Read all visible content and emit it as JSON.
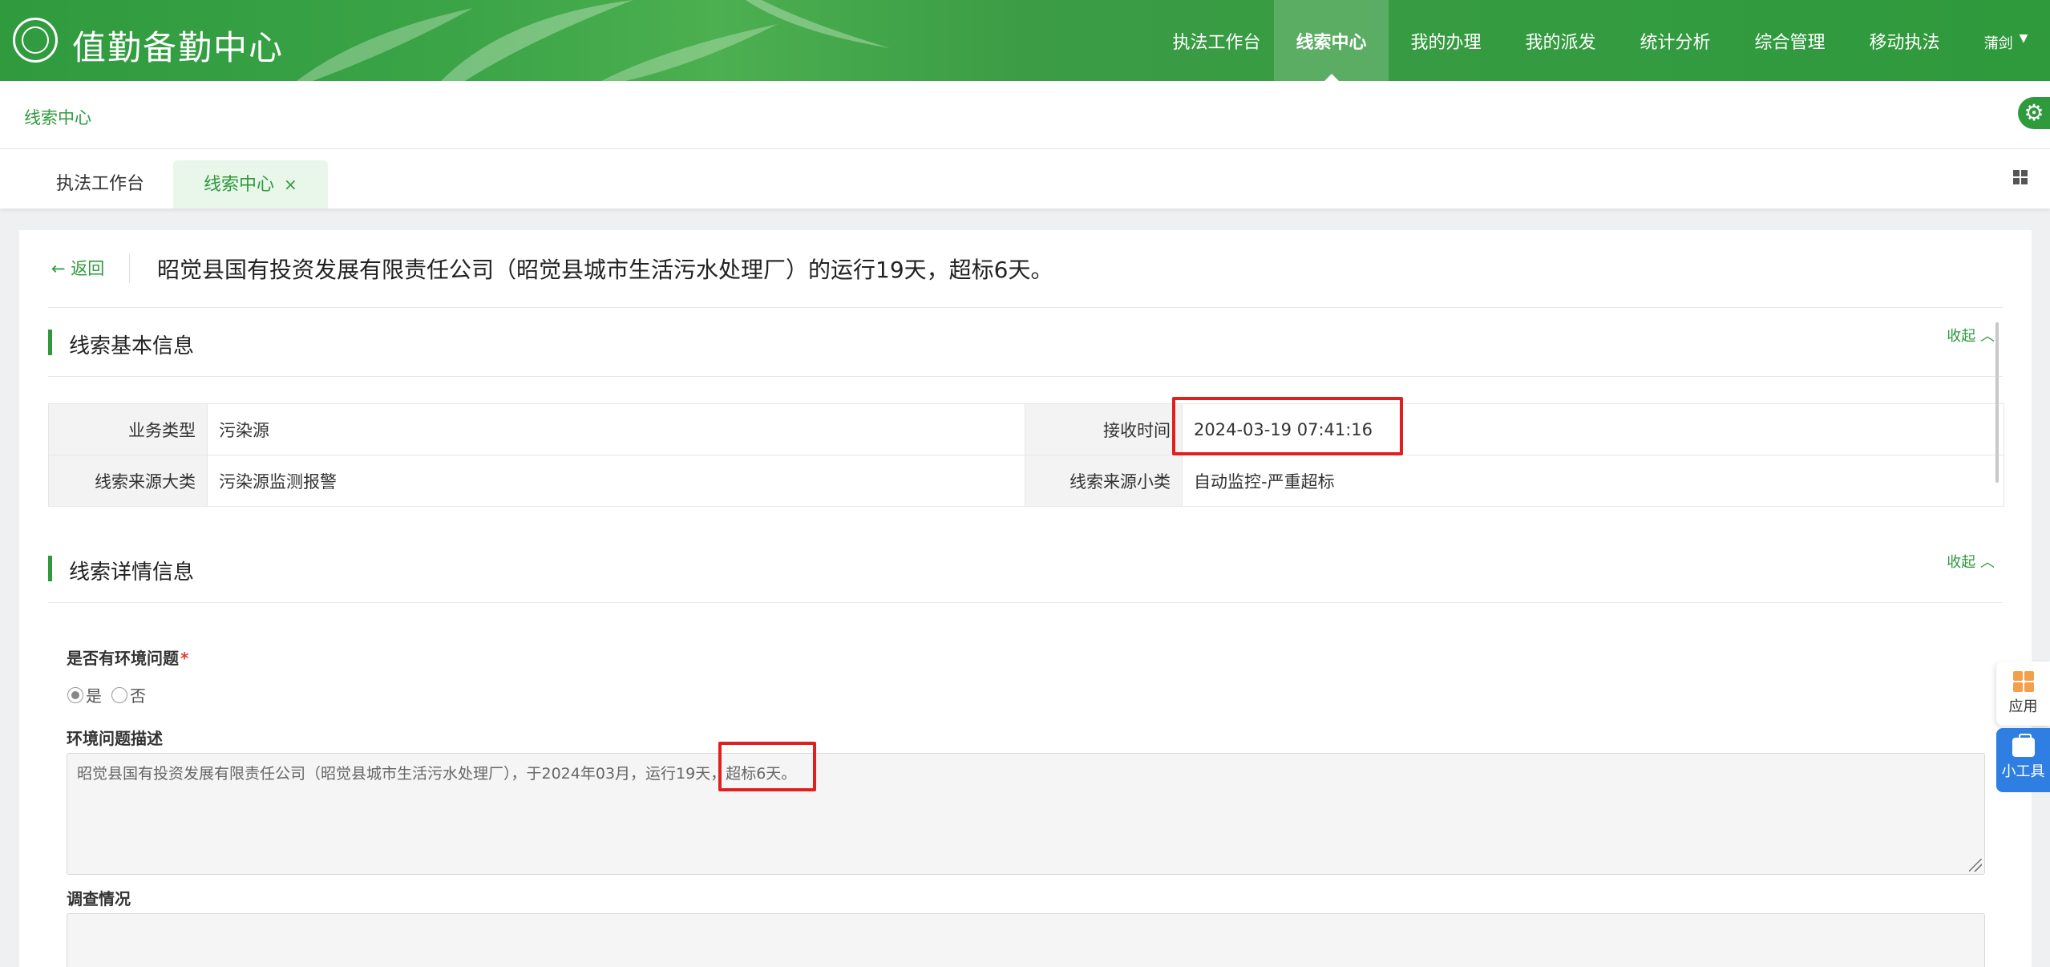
{
  "app": {
    "title": "值勤备勤中心"
  },
  "nav": {
    "items": [
      {
        "label": "执法工作台",
        "active": false
      },
      {
        "label": "线索中心",
        "active": true
      },
      {
        "label": "我的办理",
        "active": false
      },
      {
        "label": "我的派发",
        "active": false
      },
      {
        "label": "统计分析",
        "active": false
      },
      {
        "label": "综合管理",
        "active": false
      },
      {
        "label": "移动执法",
        "active": false
      }
    ],
    "user": "蒲剑"
  },
  "breadcrumb": "线索中心",
  "tabs": [
    {
      "label": "执法工作台",
      "active": false
    },
    {
      "label": "线索中心",
      "active": true,
      "close": "×"
    }
  ],
  "page": {
    "back": "返回",
    "title": "昭觉县国有投资发展有限责任公司（昭觉县城市生活污水处理厂）的运行19天，超标6天。"
  },
  "basic_info": {
    "title": "线索基本信息",
    "collapse": "收起",
    "rows": [
      {
        "l1": "业务类型",
        "v1": "污染源",
        "l2": "接收时间",
        "v2": "2024-03-19 07:41:16"
      },
      {
        "l1": "线索来源大类",
        "v1": "污染源监测报警",
        "l2": "线索来源小类",
        "v2": "自动监控-严重超标"
      }
    ]
  },
  "detail_info": {
    "title": "线索详情信息",
    "collapse": "收起",
    "env_issue_label": "是否有环境问题",
    "required_mark": "*",
    "options": [
      "是",
      "否"
    ],
    "selected": "是",
    "desc_label": "环境问题描述",
    "desc_value": "昭觉县国有投资发展有限责任公司（昭觉县城市生活污水处理厂），于2024年03月，运行19天，超标6天。",
    "survey_label": "调查情况",
    "survey_value": ""
  },
  "side_tools": {
    "app": "应用",
    "tools": "小工具"
  },
  "colors": {
    "brand": "#2e9a3c",
    "highlight": "#e02020",
    "tool_blue": "#2f7fe3"
  }
}
